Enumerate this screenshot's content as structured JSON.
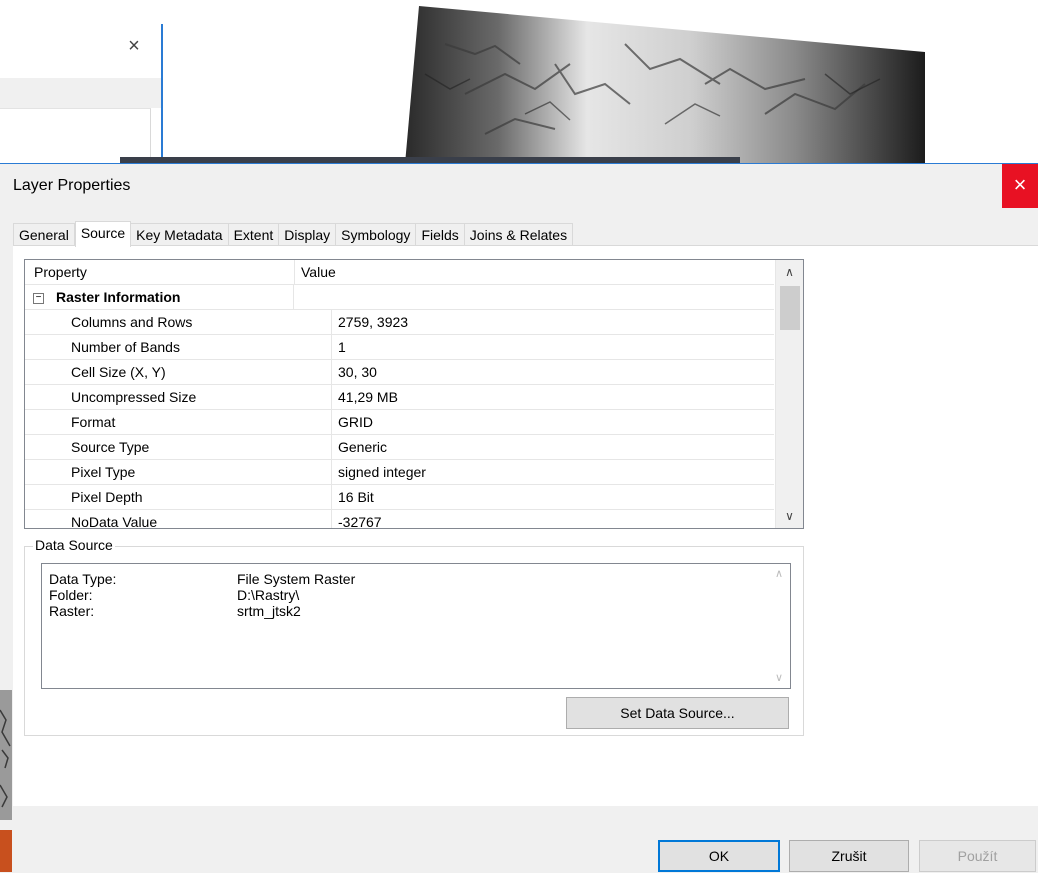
{
  "background": {
    "left_window_close_glyph": "×"
  },
  "dialog": {
    "title": "Layer Properties",
    "close_glyph": "×",
    "tabs": [
      {
        "label": "General"
      },
      {
        "label": "Source"
      },
      {
        "label": "Key Metadata"
      },
      {
        "label": "Extent"
      },
      {
        "label": "Display"
      },
      {
        "label": "Symbology"
      },
      {
        "label": "Fields"
      },
      {
        "label": "Joins & Relates"
      }
    ],
    "active_tab": "Source",
    "grid": {
      "header": {
        "property": "Property",
        "value": "Value"
      },
      "section": {
        "expander": "−",
        "label": "Raster Information"
      },
      "rows": [
        {
          "property": "Columns and Rows",
          "value": "2759, 3923"
        },
        {
          "property": "Number of Bands",
          "value": "1"
        },
        {
          "property": "Cell Size (X, Y)",
          "value": "30, 30"
        },
        {
          "property": "Uncompressed Size",
          "value": "41,29 MB"
        },
        {
          "property": "Format",
          "value": "GRID"
        },
        {
          "property": "Source Type",
          "value": "Generic"
        },
        {
          "property": "Pixel Type",
          "value": "signed integer"
        },
        {
          "property": "Pixel Depth",
          "value": "16 Bit"
        },
        {
          "property": "NoData Value",
          "value": "-32767"
        }
      ],
      "scroll_up_glyph": "∧",
      "scroll_down_glyph": "∨"
    },
    "data_source": {
      "group_label": "Data Source",
      "entries": [
        {
          "key": "Data Type:",
          "value": "File System Raster"
        },
        {
          "key": "Folder:",
          "value": "D:\\Rastry\\"
        },
        {
          "key": "Raster:",
          "value": "srtm_jtsk2"
        }
      ],
      "scroll_up_glyph": "∧",
      "scroll_down_glyph": "∨",
      "set_button_label": "Set Data Source..."
    },
    "buttons": {
      "ok": "OK",
      "cancel": "Zrušit",
      "apply": "Použít"
    },
    "colors": {
      "accent": "#0078d7",
      "close_red": "#e81123"
    }
  }
}
